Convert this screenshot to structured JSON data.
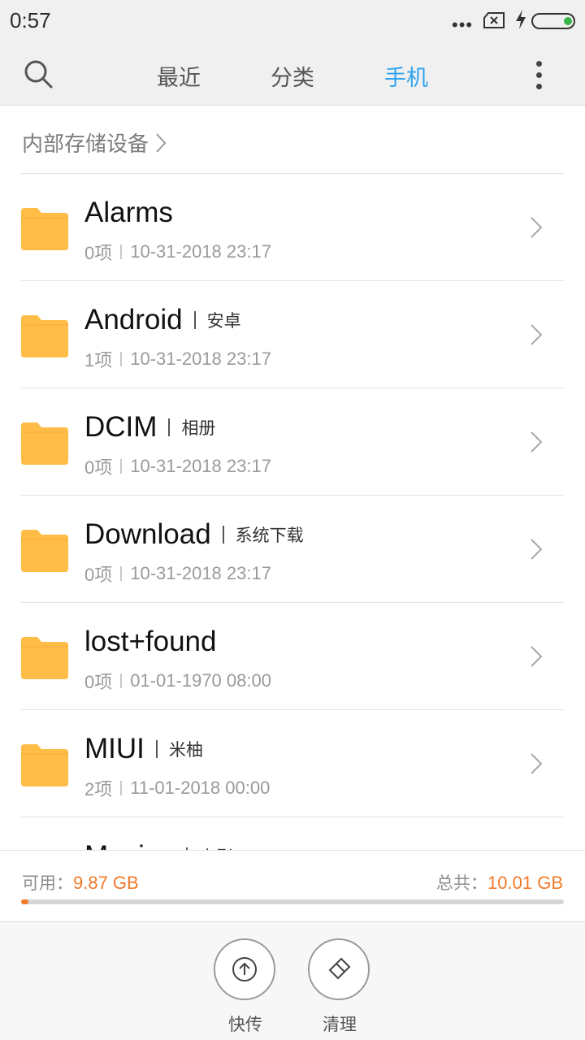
{
  "status_bar": {
    "time": "0:57",
    "signal_dots": "•••",
    "icons": [
      "sim-x-icon",
      "charging-bolt-icon",
      "battery-icon"
    ],
    "battery_color": "#3ab54a"
  },
  "nav": {
    "tabs": [
      {
        "label": "最近"
      },
      {
        "label": "分类"
      },
      {
        "label": "手机",
        "active": true
      }
    ],
    "active_color": "#2ea3ee"
  },
  "breadcrumb": {
    "label": "内部存储设备"
  },
  "files": [
    {
      "name": "Alarms",
      "alias": "",
      "count": "0项",
      "date": "10-31-2018 23:17"
    },
    {
      "name": "Android",
      "alias": "安卓",
      "count": "1项",
      "date": "10-31-2018 23:17"
    },
    {
      "name": "DCIM",
      "alias": "相册",
      "count": "0项",
      "date": "10-31-2018 23:17"
    },
    {
      "name": "Download",
      "alias": "系统下载",
      "count": "0项",
      "date": "10-31-2018 23:17"
    },
    {
      "name": "lost+found",
      "alias": "",
      "count": "0项",
      "date": "01-01-1970 08:00"
    },
    {
      "name": "MIUI",
      "alias": "米柚",
      "count": "2项",
      "date": "11-01-2018 00:00"
    },
    {
      "name": "Movies",
      "alias": "电影",
      "count": "",
      "date": ""
    }
  ],
  "storage": {
    "available_label": "可用：",
    "available_value": "9.87 GB",
    "total_label": "总共：",
    "total_value": "10.01 GB",
    "used_fraction": 0.014,
    "accent": "#f07a2a"
  },
  "actions": {
    "share_label": "快传",
    "clean_label": "清理"
  },
  "folder_color": "#ffbd47"
}
